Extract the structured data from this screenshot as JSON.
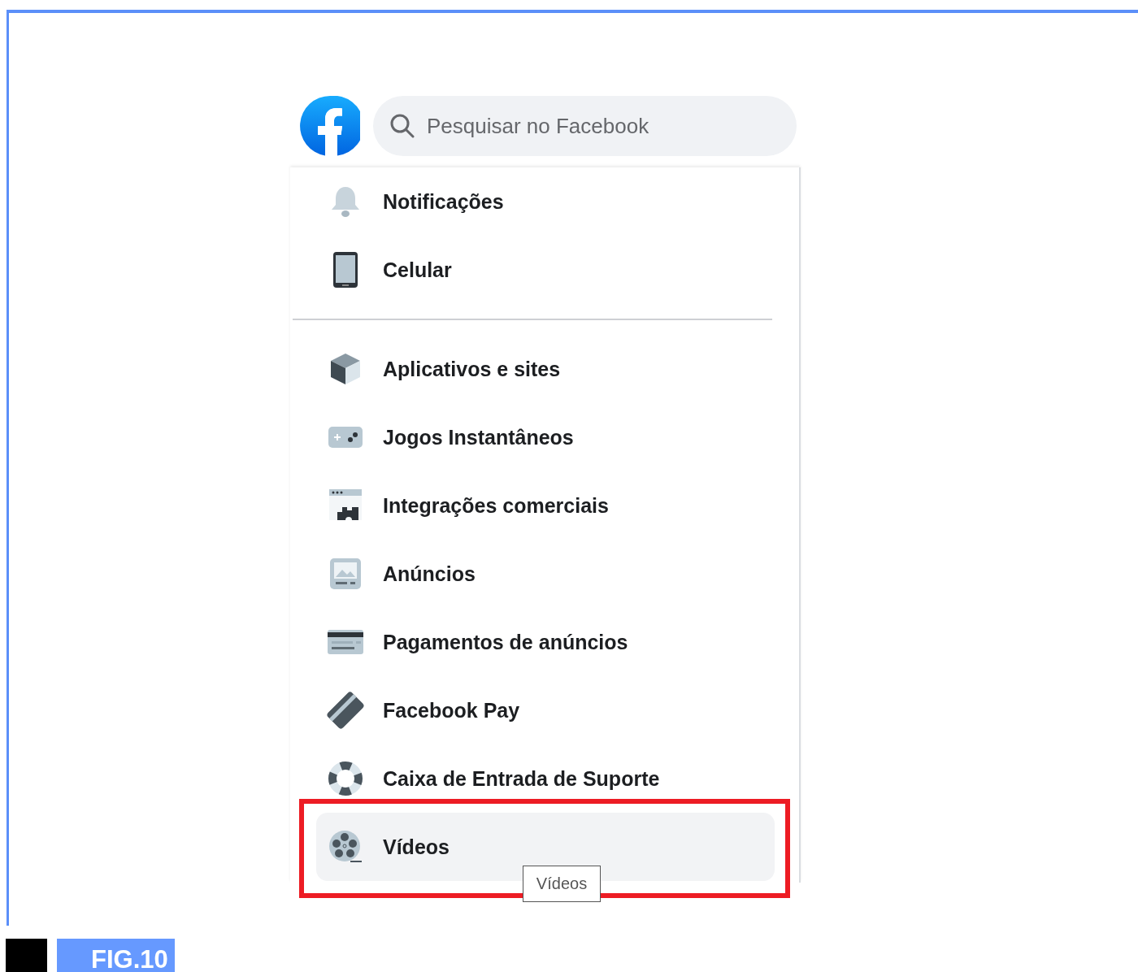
{
  "search": {
    "placeholder": "Pesquisar no Facebook"
  },
  "menu_groups": [
    {
      "items": [
        {
          "label": "Notificações",
          "selected": false,
          "annotated": false
        },
        {
          "label": "Celular",
          "selected": false,
          "annotated": false
        }
      ]
    },
    {
      "items": [
        {
          "label": "Aplicativos e sites",
          "selected": false,
          "annotated": false
        },
        {
          "label": "Jogos Instantâneos",
          "selected": false,
          "annotated": false
        },
        {
          "label": "Integrações comerciais",
          "selected": false,
          "annotated": false
        },
        {
          "label": "Anúncios",
          "selected": false,
          "annotated": false
        },
        {
          "label": "Pagamentos de anúncios",
          "selected": false,
          "annotated": false
        },
        {
          "label": "Facebook Pay",
          "selected": false,
          "annotated": false
        },
        {
          "label": "Caixa de Entrada de Suporte",
          "selected": false,
          "annotated": false
        },
        {
          "label": "Vídeos",
          "selected": true,
          "annotated": true,
          "tooltip": "Vídeos"
        }
      ]
    }
  ],
  "figure_label": "FIG.10"
}
